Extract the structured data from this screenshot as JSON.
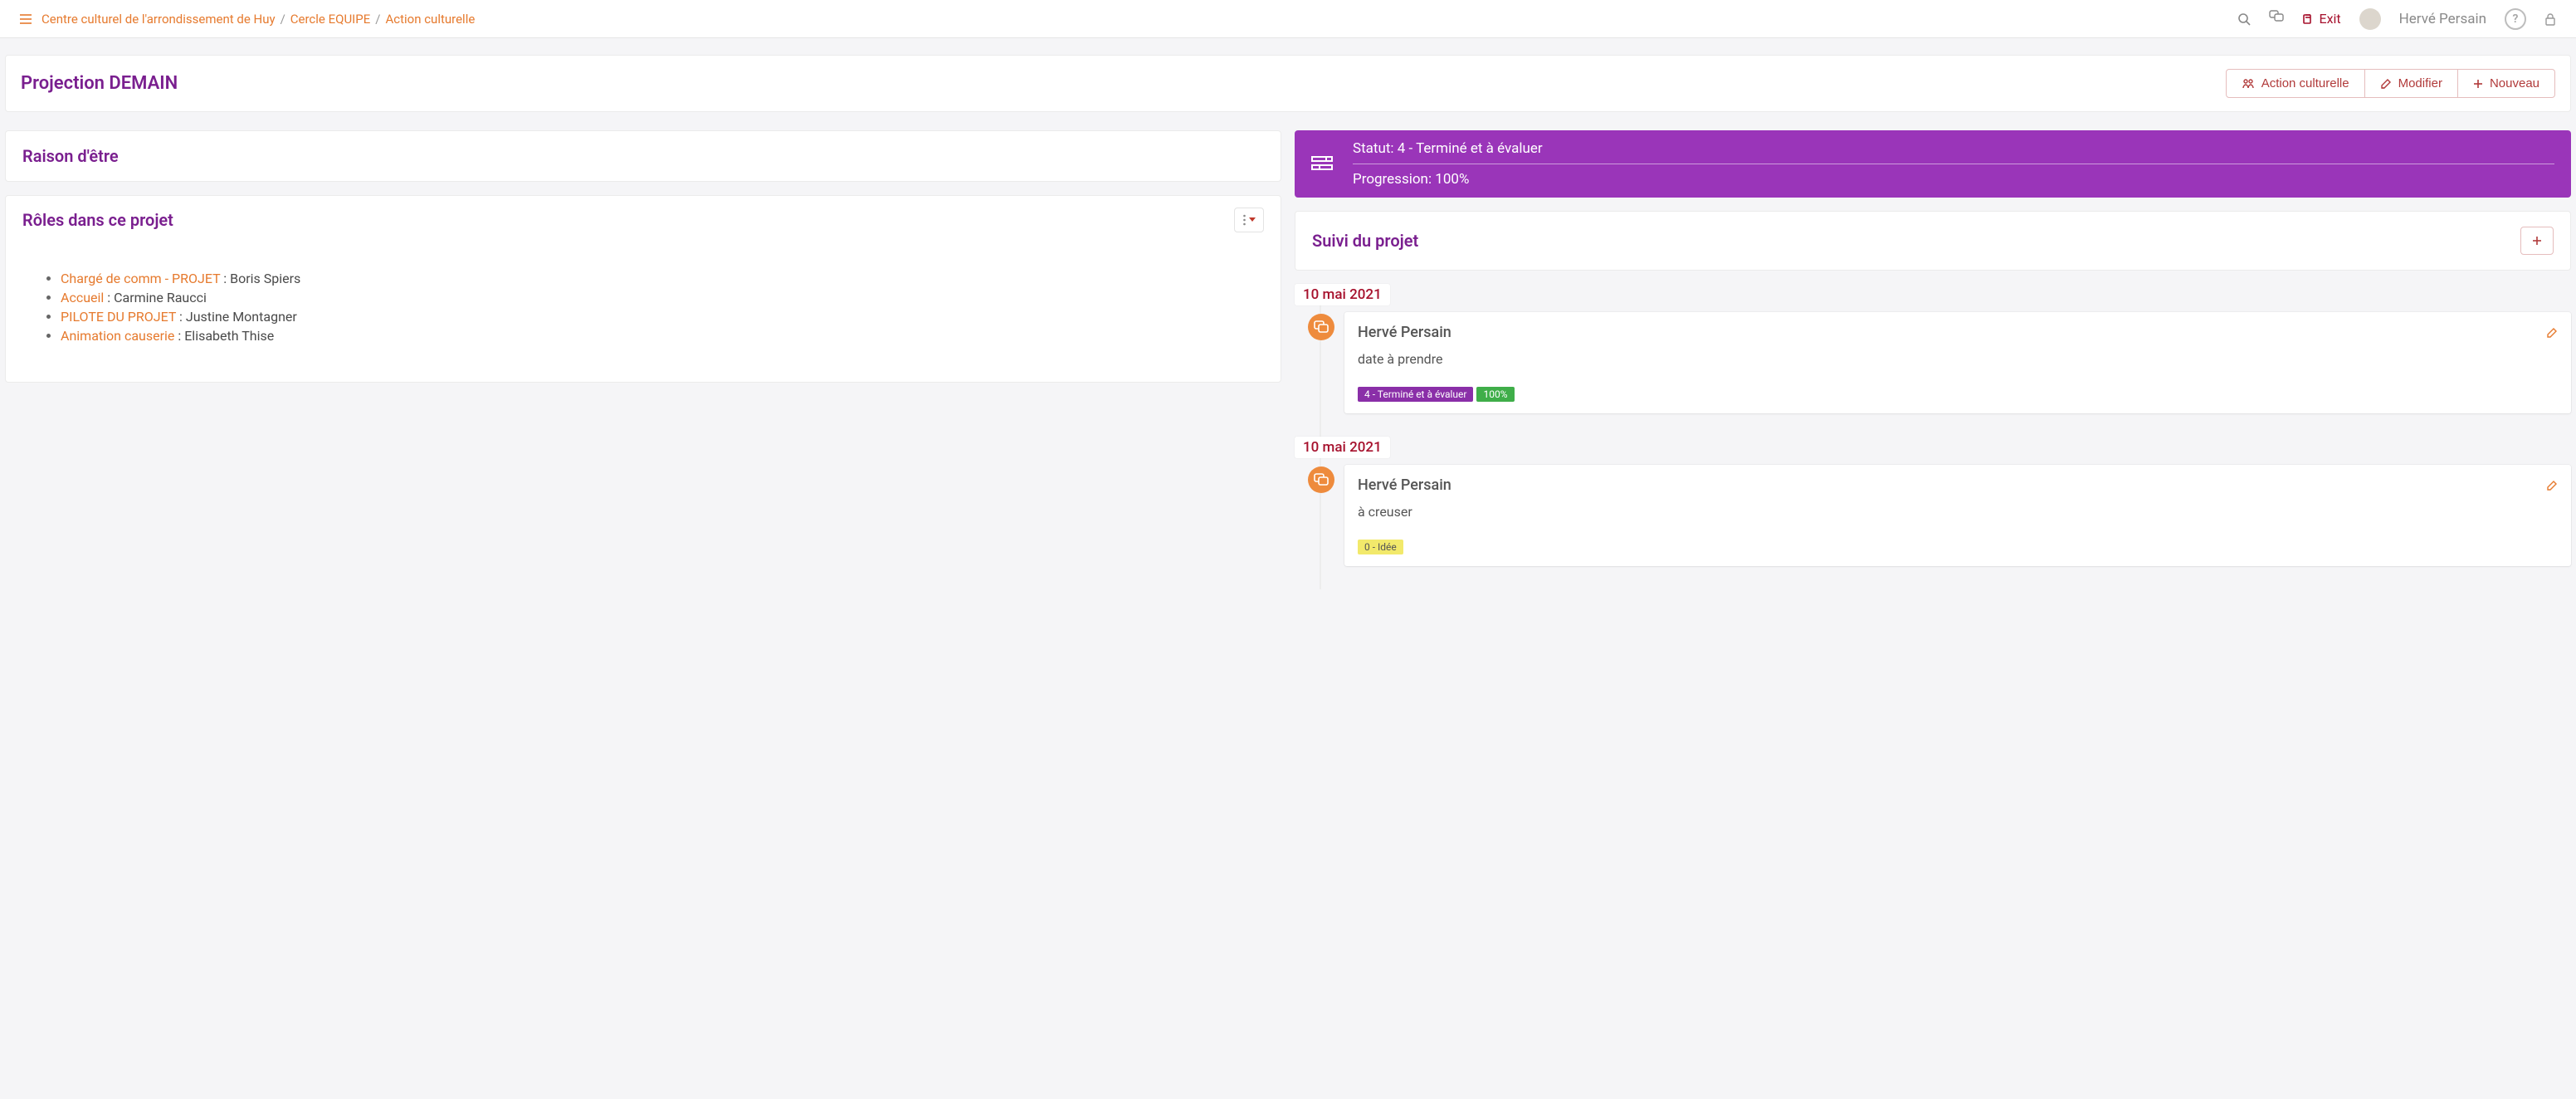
{
  "header": {
    "breadcrumb": [
      "Centre culturel de l'arrondissement de Huy",
      "Cercle EQUIPE",
      "Action culturelle"
    ],
    "exit_label": "Exit",
    "user_name": "Hervé Persain"
  },
  "page": {
    "title": "Projection DEMAIN",
    "buttons": {
      "action_culturelle": "Action culturelle",
      "modifier": "Modifier",
      "nouveau": "Nouveau"
    }
  },
  "left": {
    "raison_title": "Raison d'être",
    "roles_title": "Rôles dans ce projet",
    "roles": [
      {
        "role": "Chargé de comm - PROJET",
        "sep": " : ",
        "person": "Boris Spiers"
      },
      {
        "role": "Accueil",
        "sep": " : ",
        "person": "Carmine Raucci"
      },
      {
        "role": "PILOTE DU PROJET",
        "sep": " : ",
        "person": "Justine Montagner"
      },
      {
        "role": "Animation causerie",
        "sep": " : ",
        "person": "Elisabeth Thise"
      }
    ]
  },
  "right": {
    "status_label": "Statut: 4 - Terminé et à évaluer",
    "progression_label": "Progression: 100%",
    "suivi_title": "Suivi du projet",
    "entries": [
      {
        "date": "10 mai 2021",
        "author": "Hervé Persain",
        "body": "date à prendre",
        "badges": [
          {
            "text": "4 - Terminé et à évaluer",
            "style": "purple"
          },
          {
            "text": "100%",
            "style": "green"
          }
        ]
      },
      {
        "date": "10 mai 2021",
        "author": "Hervé Persain",
        "body": "à creuser",
        "badges": [
          {
            "text": "0 - Idée",
            "style": "yellow"
          }
        ]
      }
    ]
  }
}
